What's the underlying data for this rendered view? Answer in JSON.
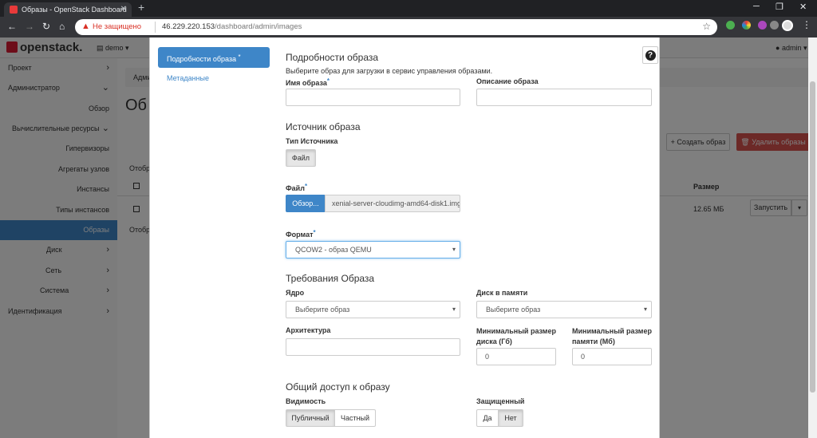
{
  "browser": {
    "tab_title": "Образы - OpenStack Dashboard",
    "security_label": "Не защищено",
    "url_host": "46.229.220.153",
    "url_path": "/dashboard/admin/images"
  },
  "topnav": {
    "logo": "openstack.",
    "project": "demo ▾",
    "user": "admin ▾"
  },
  "sidebar": {
    "items": [
      {
        "label": "Проект"
      },
      {
        "label": "Администратор"
      },
      {
        "label": "Обзор"
      },
      {
        "label": "Вычислительные ресурсы"
      },
      {
        "label": "Гипервизоры"
      },
      {
        "label": "Агрегаты узлов"
      },
      {
        "label": "Инстансы"
      },
      {
        "label": "Типы инстансов"
      },
      {
        "label": "Образы"
      },
      {
        "label": "Диск"
      },
      {
        "label": "Сеть"
      },
      {
        "label": "Система"
      },
      {
        "label": "Идентификация"
      }
    ]
  },
  "background": {
    "breadcrumb": "Адми",
    "title": "Об",
    "shown_label": "Отобр",
    "shown_label_bottom": "Отобр",
    "create_button": "Создать образ",
    "delete_button": "Удалить образы",
    "col_size": "Размер",
    "row_size": "12.65 МБ",
    "launch_button": "Запустить"
  },
  "modal": {
    "nav": [
      {
        "label": "Подробности образа"
      },
      {
        "label": "Метаданные"
      }
    ],
    "details_heading": "Подробности образа",
    "details_desc": "Выберите образ для загрузки в сервис управления образами.",
    "name_label": "Имя образа",
    "description_label": "Описание образа",
    "source_heading": "Источник образа",
    "source_type_label": "Тип Источника",
    "source_type_value": "Файл",
    "file_label": "Файл",
    "browse_button": "Обзор...",
    "file_name": "xenial-server-cloudimg-amd64-disk1.img",
    "format_label": "Формат",
    "format_value": "QCOW2 - образ QEMU",
    "requirements_heading": "Требования Образа",
    "kernel_label": "Ядро",
    "kernel_placeholder": "Выберите образ",
    "ramdisk_label": "Диск в памяти",
    "ramdisk_placeholder": "Выберите образ",
    "arch_label": "Архитектура",
    "min_disk_label_1": "Минимальный размер",
    "min_disk_label_2": "диска (Гб)",
    "min_disk_value": "0",
    "min_ram_label_1": "Минимальный размер",
    "min_ram_label_2": "памяти (Мб)",
    "min_ram_value": "0",
    "sharing_heading": "Общий доступ к образу",
    "visibility_label": "Видимость",
    "visibility_public": "Публичный",
    "visibility_private": "Частный",
    "protected_label": "Защищенный",
    "protected_yes": "Да",
    "protected_no": "Нет"
  },
  "colors": {
    "accent": "#3e86c8",
    "danger": "#d9534f",
    "logo_red": "#da1a32"
  }
}
